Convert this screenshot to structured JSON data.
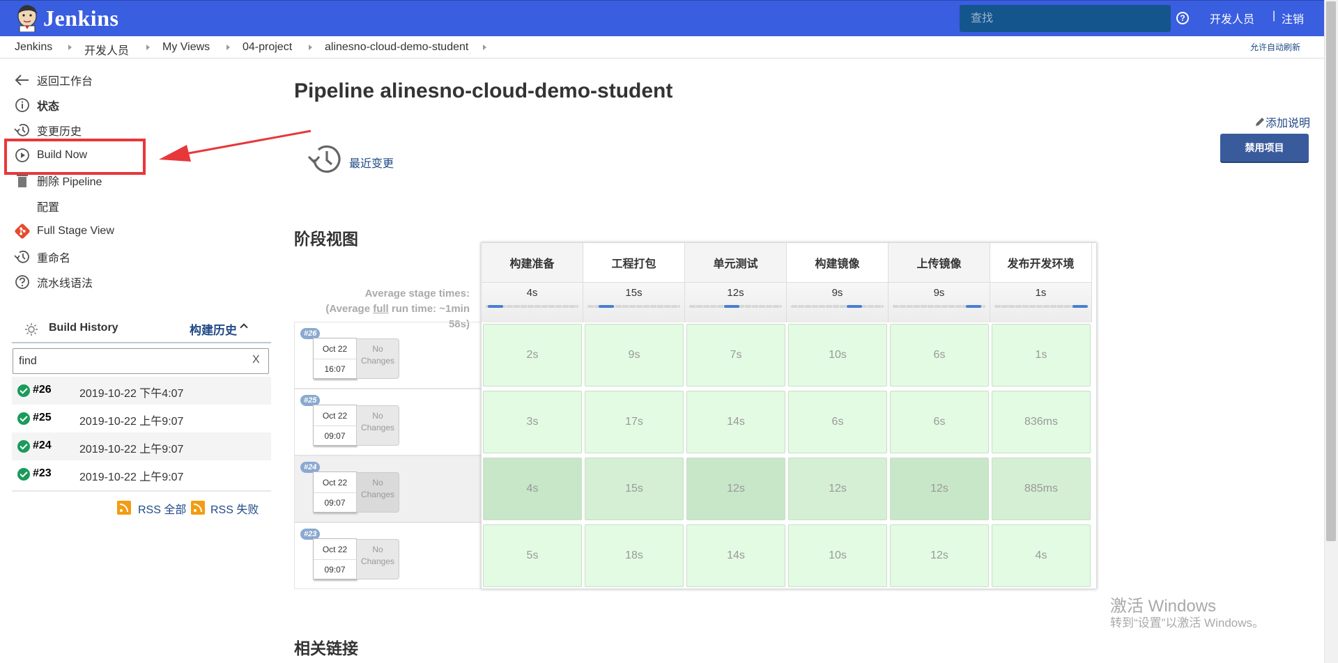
{
  "header": {
    "app_title": "Jenkins",
    "search_placeholder": "查找",
    "help_icon": "?",
    "user": "开发人员",
    "separator": "|",
    "logout": "注销"
  },
  "breadcrumb": {
    "items": [
      "Jenkins",
      "开发人员",
      "My Views",
      "04-project",
      "alinesno-cloud-demo-student"
    ],
    "auto_refresh": "允许自动刷新"
  },
  "sidebar": {
    "tasks": [
      {
        "label": "返回工作台",
        "icon": "arrow-left-icon"
      },
      {
        "label": "状态",
        "icon": "info-icon"
      },
      {
        "label": "变更历史",
        "icon": "history-icon"
      },
      {
        "label": "Build Now",
        "icon": "play-circle-icon"
      },
      {
        "label": "删除 Pipeline",
        "icon": "trash-icon"
      },
      {
        "label": "配置",
        "icon": "gear-icon"
      },
      {
        "label": "Full Stage View",
        "icon": "git-diamond-icon"
      },
      {
        "label": "重命名",
        "icon": "history-icon"
      },
      {
        "label": "流水线语法",
        "icon": "help-circle-icon"
      }
    ]
  },
  "build_history": {
    "title": "Build History",
    "trend_link": "构建历史",
    "filter_value": "find",
    "clear": "X",
    "builds": [
      {
        "number": "#26",
        "time": "2019-10-22 下午4:07"
      },
      {
        "number": "#25",
        "time": "2019-10-22 上午9:07"
      },
      {
        "number": "#24",
        "time": "2019-10-22 上午9:07"
      },
      {
        "number": "#23",
        "time": "2019-10-22 上午9:07"
      }
    ],
    "rss_all": "RSS 全部",
    "rss_failed": "RSS 失败"
  },
  "main": {
    "title": "Pipeline alinesno-cloud-demo-student",
    "add_description": "添加说明",
    "disable_button": "禁用项目",
    "recent_changes": "最近变更",
    "stage_view_title": "阶段视图",
    "related_links_title": "相关链接"
  },
  "stage_view": {
    "avg_line1": "Average stage times:",
    "avg_line2_pre": "(Average ",
    "avg_line2_link": "full",
    "avg_line2_post": " run time: ~1min",
    "avg_line3": "58s)",
    "stages": [
      {
        "name": "构建准备",
        "avg": "4s",
        "bar_pos": 0.02
      },
      {
        "name": "工程打包",
        "avg": "15s",
        "bar_pos": 0.12
      },
      {
        "name": "单元测试",
        "avg": "12s",
        "bar_pos": 0.37
      },
      {
        "name": "构建镜像",
        "avg": "9s",
        "bar_pos": 0.6
      },
      {
        "name": "上传镜像",
        "avg": "9s",
        "bar_pos": 0.78
      },
      {
        "name": "发布开发环境",
        "avg": "1s",
        "bar_pos": 0.97
      }
    ],
    "runs": [
      {
        "badge": "#26",
        "date": "Oct 22",
        "time": "16:07",
        "changes": [
          "No",
          "Changes"
        ],
        "durations": [
          "2s",
          "9s",
          "7s",
          "10s",
          "6s",
          "1s"
        ]
      },
      {
        "badge": "#25",
        "date": "Oct 22",
        "time": "09:07",
        "changes": [
          "No",
          "Changes"
        ],
        "durations": [
          "3s",
          "17s",
          "14s",
          "6s",
          "6s",
          "836ms"
        ]
      },
      {
        "badge": "#24",
        "date": "Oct 22",
        "time": "09:07",
        "changes": [
          "No",
          "Changes"
        ],
        "durations": [
          "4s",
          "15s",
          "12s",
          "12s",
          "12s",
          "885ms"
        ]
      },
      {
        "badge": "#23",
        "date": "Oct 22",
        "time": "09:07",
        "changes": [
          "No",
          "Changes"
        ],
        "durations": [
          "5s",
          "18s",
          "14s",
          "10s",
          "12s",
          "4s"
        ]
      }
    ]
  },
  "watermark": {
    "line1": "激活 Windows",
    "line2": "转到“设置”以激活 Windows。"
  },
  "colors": {
    "header_bg": "#3a5ee0",
    "success_cell": "#e3fbe3",
    "highlight_red": "#e8373b",
    "link": "#204a87"
  }
}
